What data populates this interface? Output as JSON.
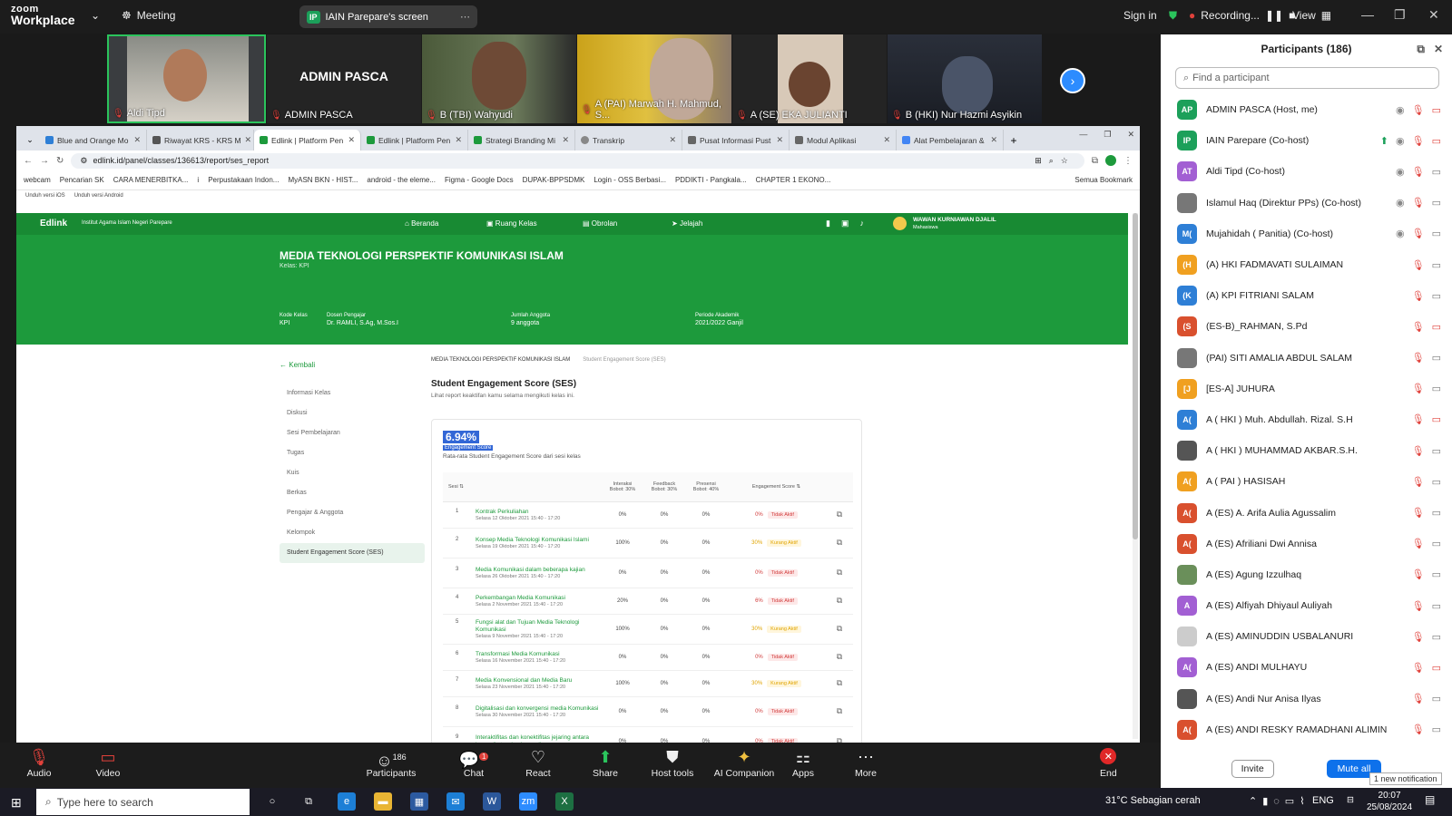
{
  "zoom": {
    "logo_top": "zoom",
    "logo_bottom": "Workplace",
    "meeting": "Meeting",
    "screen_share": "IAIN Parepare's screen",
    "sign_in": "Sign in",
    "recording": "Recording...",
    "view": "View"
  },
  "videos": [
    {
      "name": "Aldi Tipd"
    },
    {
      "name": "ADMIN PASCA",
      "center": "ADMIN PASCA"
    },
    {
      "name": "B (TBI) Wahyudi"
    },
    {
      "name": "A (PAI) Marwah H. Mahmud, S..."
    },
    {
      "name": "A (SE) EKA JULIANTI"
    },
    {
      "name": "B (HKI) Nur Hazmi Asyikin"
    }
  ],
  "browser": {
    "tabs": [
      "Blue and Orange Mo",
      "Riwayat KRS - KRS M",
      "Edlink | Platform Pen",
      "Edlink | Platform Pen",
      "Strategi Branding Mi",
      "Transkrip",
      "Pusat Informasi Pust",
      "Modul Aplikasi",
      "Alat Pembelajaran &"
    ],
    "url": "edlink.id/panel/classes/136613/report/ses_report",
    "bookmarks": [
      "webcam",
      "Pencarian SK",
      "CARA MENERBITKA...",
      "i",
      "Perpustakaan Indon...",
      "MyASN BKN - HIST...",
      "android - the eleme...",
      "Figma - Google Docs",
      "DUPAK-BPPSDMK",
      "Login - OSS Berbasi...",
      "PDDIKTI - Pangkala...",
      "CHAPTER 1 EKONO..."
    ],
    "all_bookmarks": "Semua Bookmark",
    "downloads": [
      "Unduh versi iOS",
      "Unduh versi Android"
    ]
  },
  "edlink": {
    "brand": "Edlink",
    "institution": "Institut Agama Islam Negeri Parepare",
    "nav": [
      "Beranda",
      "Ruang Kelas",
      "Obrolan",
      "Jelajah"
    ],
    "user_name": "WAWAN KURNIAWAN DJALIL",
    "user_role": "Mahasiswa",
    "course_title": "MEDIA TEKNOLOGI PERSPEKTIF KOMUNIKASI ISLAM",
    "course_class": "Kelas: KPI",
    "meta": [
      {
        "label": "Kode Kelas",
        "value": "KPI"
      },
      {
        "label": "Dosen Pengajar",
        "value": "Dr. RAMLI, S.Ag, M.Sos.I"
      },
      {
        "label": "Jumlah Anggota",
        "value": "9 anggota"
      },
      {
        "label": "Periode Akademik",
        "value": "2021/2022 Ganjil"
      }
    ],
    "back": "Kembali",
    "sidebar": [
      "Informasi Kelas",
      "Diskusi",
      "Sesi Pembelajaran",
      "Tugas",
      "Kuis",
      "Berkas",
      "Pengajar & Anggota",
      "Kelompok",
      "Student Engagement Score (SES)"
    ],
    "crumb_1": "MEDIA TEKNOLOGI PERSPEKTIF KOMUNIKASI ISLAM",
    "crumb_2": "Student Engagement Score (SES)",
    "ses_title": "Student Engagement Score (SES)",
    "ses_sub": "Lihat report keaktifan kamu selama mengikuti kelas ini.",
    "score": "6.94%",
    "score_label": "Engagement Score",
    "score_desc": "Rata-rata Student Engagement Score dari sesi kelas",
    "columns": {
      "sesi": "Sesi",
      "interaksi": "Interaksi",
      "interaksi_w": "Bobot: 30%",
      "feedback": "Feedback",
      "feedback_w": "Bobot: 30%",
      "presensi": "Presensi",
      "presensi_w": "Bobot: 40%",
      "engagement": "Engagement Score"
    },
    "rows": [
      {
        "no": "1",
        "name": "Kontrak Perkuliahan",
        "date": "Selasa 12 Oktober 2021 15:40 - 17:20",
        "i": "0%",
        "f": "0%",
        "p": "0%",
        "score": "0%",
        "status": "Tidak Aktif",
        "level": "inactive"
      },
      {
        "no": "2",
        "name": "Konsep Media Teknologi Komunikasi Islami",
        "date": "Selasa 19 Oktober 2021 15:40 - 17:20",
        "i": "100%",
        "f": "0%",
        "p": "0%",
        "score": "30%",
        "status": "Kurang Aktif",
        "level": "low"
      },
      {
        "no": "3",
        "name": "Media Komunikasi dalam beberapa kajian",
        "date": "Selasa 26 Oktober 2021 15:40 - 17:20",
        "i": "0%",
        "f": "0%",
        "p": "0%",
        "score": "0%",
        "status": "Tidak Aktif",
        "level": "inactive"
      },
      {
        "no": "4",
        "name": "Perkembangan Media Komunikasi",
        "date": "Selasa 2 November 2021 15:40 - 17:20",
        "i": "20%",
        "f": "0%",
        "p": "0%",
        "score": "6%",
        "status": "Tidak Aktif",
        "level": "inactive"
      },
      {
        "no": "5",
        "name": "Fungsi alat dan Tujuan Media Teknologi Komunikasi",
        "date": "Selasa 9 November 2021 15:40 - 17:20",
        "i": "100%",
        "f": "0%",
        "p": "0%",
        "score": "30%",
        "status": "Kurang Aktif",
        "level": "low"
      },
      {
        "no": "6",
        "name": "Transformasi Media Komunikasi",
        "date": "Selasa 16 November 2021 15:40 - 17:20",
        "i": "0%",
        "f": "0%",
        "p": "0%",
        "score": "0%",
        "status": "Tidak Aktif",
        "level": "inactive"
      },
      {
        "no": "7",
        "name": "Media Konvensional dan Media Baru",
        "date": "Selasa 23 November 2021 15:40 - 17:20",
        "i": "100%",
        "f": "0%",
        "p": "0%",
        "score": "30%",
        "status": "Kurang Aktif",
        "level": "low"
      },
      {
        "no": "8",
        "name": "Digitalisasi dan konvergensi media Komunikasi",
        "date": "Selasa 30 November 2021 15:40 - 17:20",
        "i": "0%",
        "f": "0%",
        "p": "0%",
        "score": "0%",
        "status": "Tidak Aktif",
        "level": "inactive"
      },
      {
        "no": "9",
        "name": "Interaktifitas dan konektifitas jejaring antara komunikator dan komunikan",
        "date": "",
        "i": "0%",
        "f": "0%",
        "p": "0%",
        "score": "0%",
        "status": "Tidak Aktif",
        "level": "inactive"
      }
    ]
  },
  "participants": {
    "title": "Participants (186)",
    "search_placeholder": "Find a participant",
    "invite": "Invite",
    "mute_all": "Mute all",
    "notification": "1 new notification",
    "list": [
      {
        "initials": "AP",
        "name": "ADMIN PASCA (Host, me)",
        "color": "#1ca05a"
      },
      {
        "initials": "IP",
        "name": "IAIN Parepare (Co-host)",
        "color": "#1ca05a"
      },
      {
        "initials": "AT",
        "name": "Aldi Tipd (Co-host)",
        "color": "#a25fd3"
      },
      {
        "initials": "",
        "name": "Islamul Haq (Direktur PPs) (Co-host)",
        "color": "#777777"
      },
      {
        "initials": "M(",
        "name": "Mujahidah ( Panitia) (Co-host)",
        "color": "#2e7fd6"
      },
      {
        "initials": "(H",
        "name": "(A) HKI FADMAVATI SULAIMAN",
        "color": "#f0a020"
      },
      {
        "initials": "(K",
        "name": "(A) KPI  FITRIANI SALAM",
        "color": "#2e7fd6"
      },
      {
        "initials": "(S",
        "name": "(ES-B)_RAHMAN, S.Pd",
        "color": "#d9502e"
      },
      {
        "initials": "",
        "name": "(PAI) SITI AMALIA ABDUL SALAM",
        "color": "#777777"
      },
      {
        "initials": "[J",
        "name": "[ES-A] JUHURA",
        "color": "#f0a020"
      },
      {
        "initials": "A(",
        "name": "A ( HKI ) Muh. Abdullah. Rizal. S.H",
        "color": "#2e7fd6"
      },
      {
        "initials": "",
        "name": "A ( HKI ) MUHAMMAD AKBAR.S.H.",
        "color": "#555555"
      },
      {
        "initials": "A(",
        "name": "A ( PAI ) HASISAH",
        "color": "#f0a020"
      },
      {
        "initials": "A(",
        "name": "A (ES) A. Arifa Aulia Agussalim",
        "color": "#d9502e"
      },
      {
        "initials": "A(",
        "name": "A (ES) Afriliani Dwi Annisa",
        "color": "#d9502e"
      },
      {
        "initials": "",
        "name": "A (ES) Agung Izzulhaq",
        "color": "#6a8f5a"
      },
      {
        "initials": "A",
        "name": "A (ES) Alfiyah Dhiyaul Auliyah",
        "color": "#a25fd3"
      },
      {
        "initials": "",
        "name": "A (ES) AMINUDDIN USBALANURI",
        "color": "#cccccc"
      },
      {
        "initials": "A(",
        "name": "A (ES) ANDI MULHAYU",
        "color": "#a25fd3"
      },
      {
        "initials": "",
        "name": "A (ES) Andi Nur Anisa Ilyas",
        "color": "#555555"
      },
      {
        "initials": "A(",
        "name": "A (ES) ANDI RESKY RAMADHANI ALIMIN",
        "color": "#d9502e"
      }
    ]
  },
  "controls": {
    "audio": "Audio",
    "video": "Video",
    "participants": "Participants",
    "participant_count": "186",
    "chat": "Chat",
    "chat_badge": "1",
    "react": "React",
    "share": "Share",
    "host_tools": "Host tools",
    "ai_companion": "AI Companion",
    "apps": "Apps",
    "more": "More",
    "end": "End"
  },
  "taskbar": {
    "search": "Type here to search",
    "weather": "31°C  Sebagian cerah",
    "lang": "ENG",
    "time": "20:07",
    "date": "25/08/2024"
  }
}
